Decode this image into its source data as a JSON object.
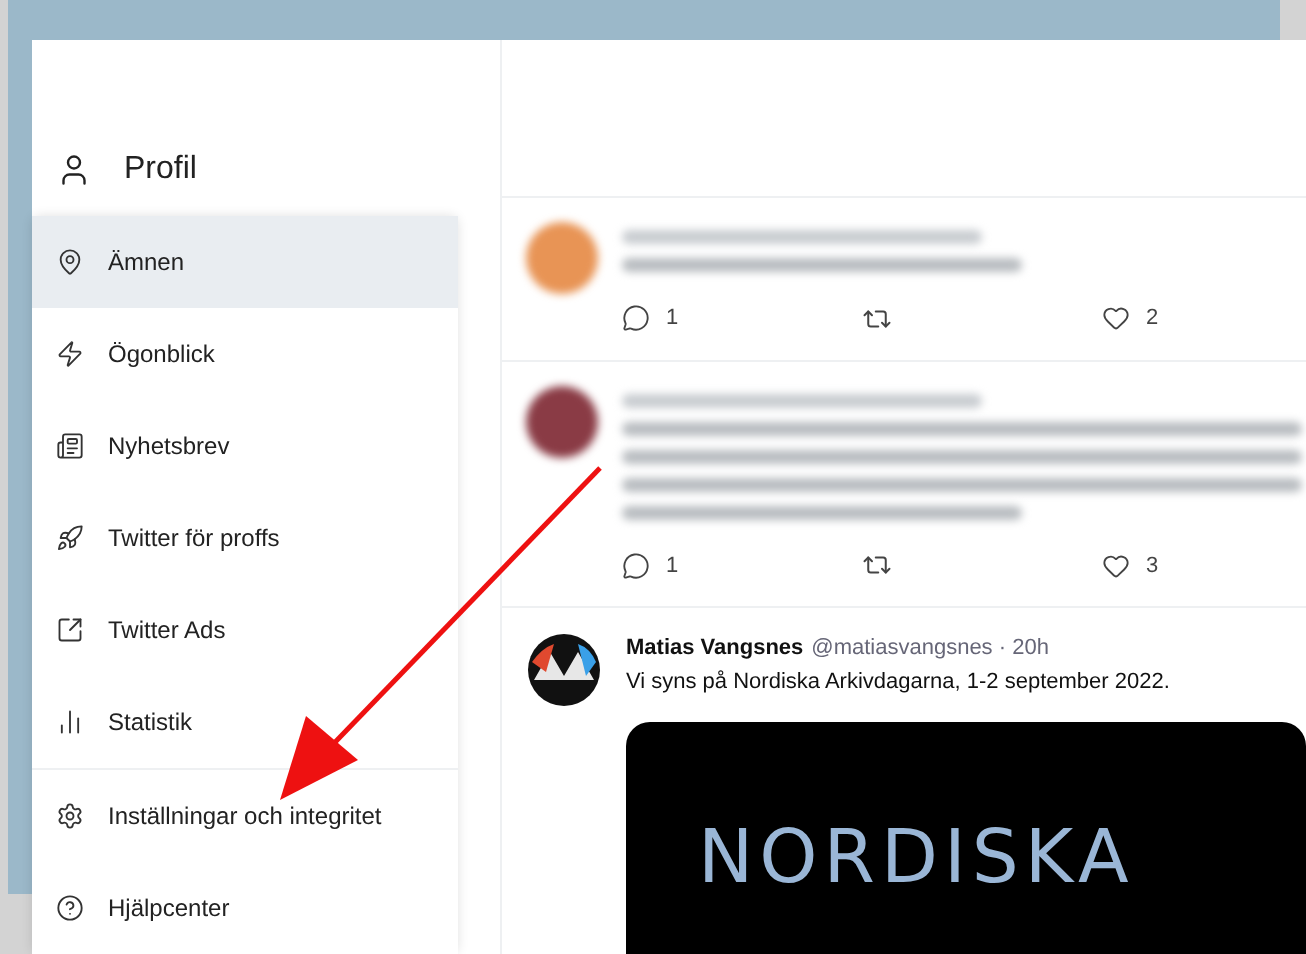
{
  "sidebar": {
    "profile": "Profil",
    "items": [
      {
        "label": "Ämnen",
        "selected": true
      },
      {
        "label": "Ögonblick",
        "selected": false
      },
      {
        "label": "Nyhetsbrev",
        "selected": false
      },
      {
        "label": "Twitter för proffs",
        "selected": false
      },
      {
        "label": "Twitter Ads",
        "selected": false
      },
      {
        "label": "Statistik",
        "selected": false
      }
    ],
    "footer_items": [
      {
        "label": "Inställningar och integritet",
        "selected": false
      },
      {
        "label": "Hjälpcenter",
        "selected": false
      }
    ]
  },
  "tweets": [
    {
      "kind": "blurred",
      "replies": "1",
      "likes": "2"
    },
    {
      "kind": "blurred",
      "replies": "1",
      "likes": "3"
    },
    {
      "kind": "plain",
      "name": "Matias Vangsnes",
      "meta": "@matiasvangsnes · 20h",
      "text": "Vi syns på Nordiska Arkivdagarna, 1-2 september 2022.",
      "media_text": "NORDISKA"
    }
  ]
}
